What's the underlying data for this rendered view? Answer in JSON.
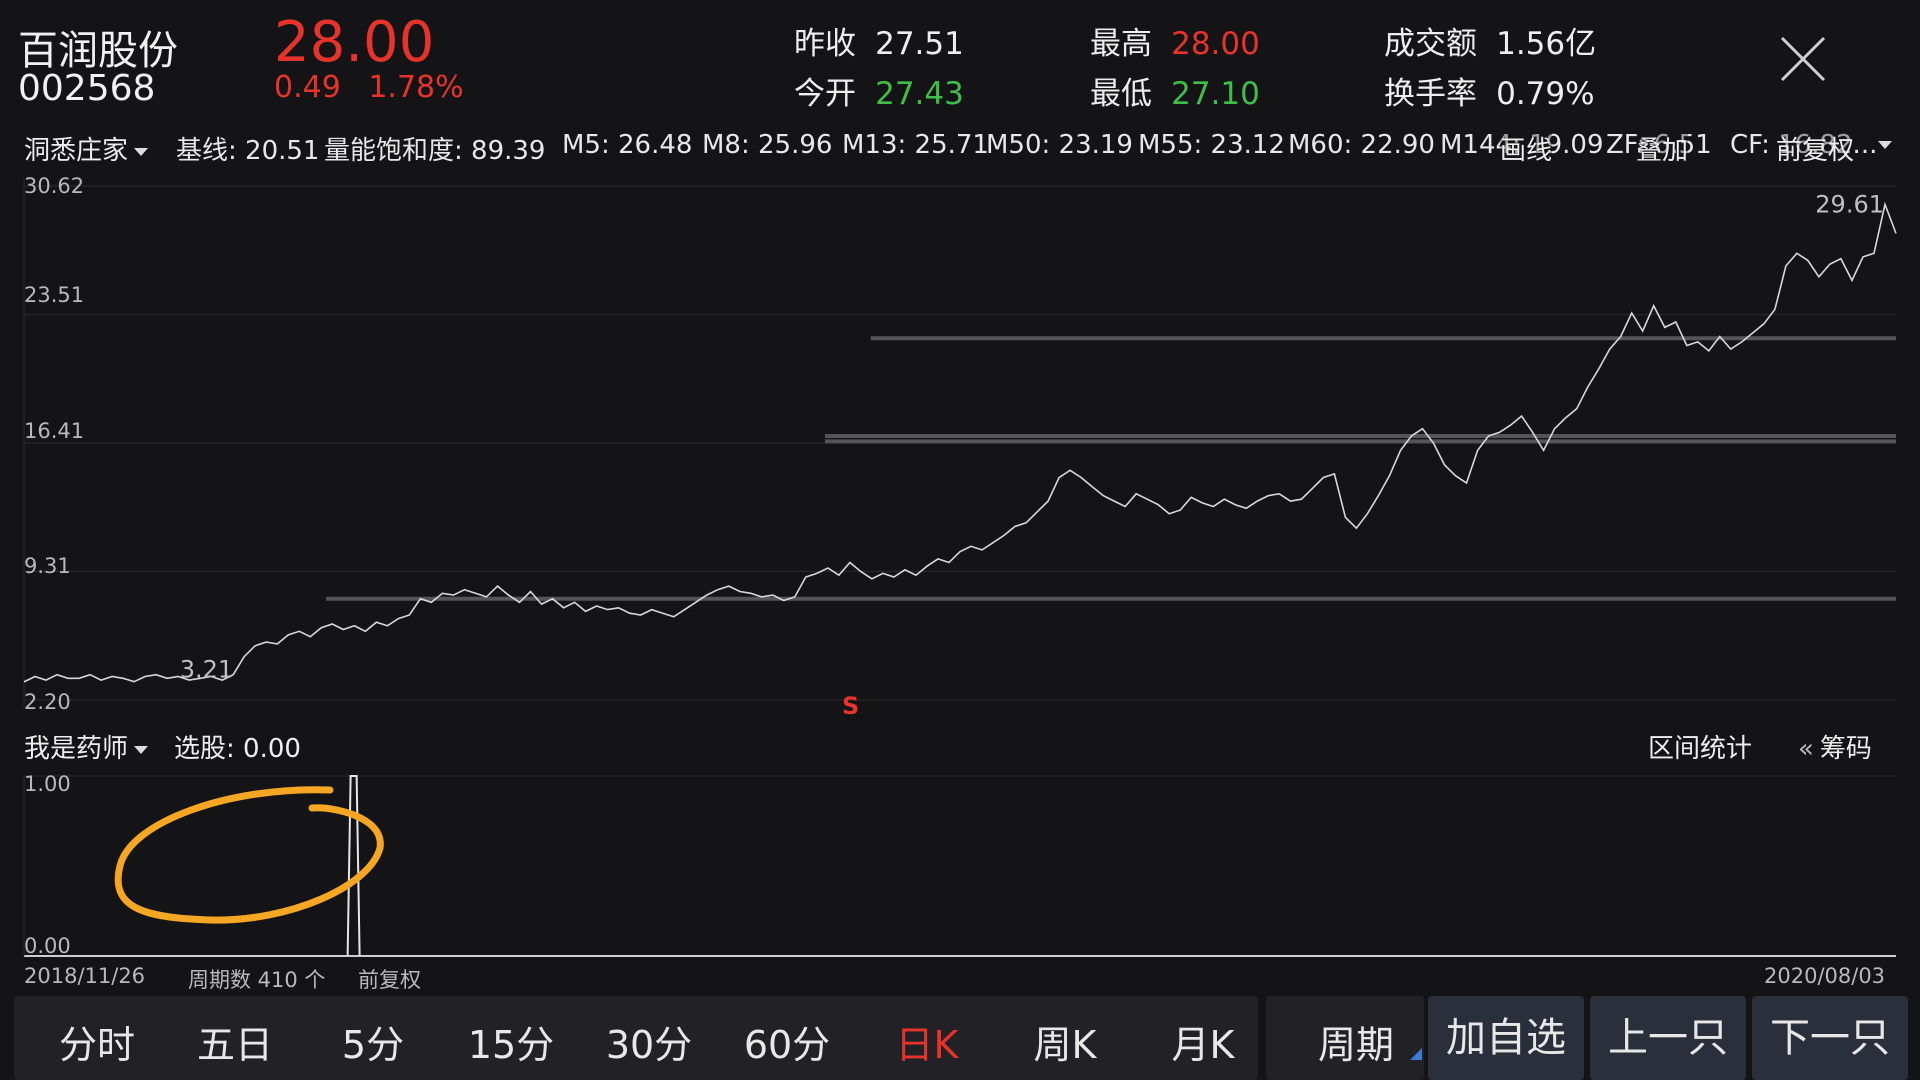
{
  "header": {
    "stock_name": "百润股份",
    "stock_code": "002568",
    "price": "28.00",
    "change": "0.49",
    "change_pct": "1.78%",
    "quotes": [
      {
        "label": "昨收",
        "value": "27.51",
        "color": "#eeeeee"
      },
      {
        "label": "今开",
        "value": "27.43",
        "color": "#3fbf4a"
      },
      {
        "label": "最高",
        "value": "28.00",
        "color": "#e8322c"
      },
      {
        "label": "最低",
        "value": "27.10",
        "color": "#3fbf4a"
      },
      {
        "label": "成交额",
        "value": "1.56亿",
        "color": "#eeeeee"
      },
      {
        "label": "换手率",
        "value": "0.79%",
        "color": "#eeeeee"
      }
    ]
  },
  "indicator_bar": {
    "selector": "洞悉庄家",
    "items": [
      {
        "text": "基线: 20.51",
        "color": "#e6d94a"
      },
      {
        "text": "量能饱和度: 89.39",
        "color": "#d94be0"
      },
      {
        "text": "M5: 26.48",
        "color": "#d94be0"
      },
      {
        "text": "M8: 25.96",
        "color": "#e6d94a"
      },
      {
        "text": "M13: 25.71",
        "color": "#8b7cf0"
      },
      {
        "text": "M50: 23.19",
        "color": "#f2f2f2"
      },
      {
        "text": "M55: 23.12",
        "color": "#3fbf4a"
      },
      {
        "text": "M60: 22.90",
        "color": "#e8322c"
      },
      {
        "text": "M144: 19.09",
        "color": "#3fbf4a"
      },
      {
        "text": "ZF: 6.51",
        "color": "#d94be0"
      },
      {
        "text": "CF: 16.82...",
        "color": "#e6d94a"
      }
    ],
    "overlay_buttons": [
      "画线",
      "叠加",
      "前复权"
    ]
  },
  "main_chart_axis": [
    "30.62",
    "23.51",
    "16.41",
    "9.31",
    "2.20"
  ],
  "signal_mark": "S",
  "sub_panel": {
    "selector": "我是药师",
    "indicator": "选股: 0.00",
    "interval_stats": "区间统计",
    "chips": "筹码",
    "axis": [
      "1.00",
      "0.00"
    ]
  },
  "footer": {
    "start_date": "2018/11/26",
    "period_count": "周期数 410 个",
    "adjust": "前复权",
    "end_date": "2020/08/03"
  },
  "toolbar": {
    "tabs": [
      "分时",
      "五日",
      "5分",
      "15分",
      "30分",
      "60分",
      "日K",
      "周K",
      "月K"
    ],
    "active_tab": "日K",
    "period": "周期",
    "add_watch": "加自选",
    "prev": "上一只",
    "next": "下一只"
  },
  "chart_data": {
    "type": "line",
    "ylim": [
      2.2,
      30.62
    ],
    "y_ticks": [
      30.62,
      23.51,
      16.41,
      9.31,
      2.2
    ],
    "x_range": [
      "2018/11/26",
      "2020/08/03"
    ],
    "period_count": 410,
    "annotations": [
      {
        "text": "3.21",
        "x_index": 10,
        "y": 3.21
      },
      {
        "text": "29.61",
        "x_index": 405,
        "y": 29.61
      }
    ],
    "series": [
      {
        "values": [
          3.2,
          3.5,
          3.3,
          3.6,
          3.4,
          3.4,
          3.6,
          3.3,
          3.5,
          3.4,
          3.21,
          3.5,
          3.6,
          3.4,
          3.5,
          3.3,
          3.4,
          3.5,
          3.3,
          3.6,
          4.6,
          5.2,
          5.4,
          5.3,
          5.8,
          6.0,
          5.7,
          6.2,
          6.4,
          6.1,
          6.3,
          6.0,
          6.5,
          6.3,
          6.7,
          6.9,
          7.8,
          7.6,
          8.1,
          8.0,
          8.3,
          8.1,
          7.9,
          8.5,
          8.0,
          7.6,
          8.2,
          7.5,
          7.8,
          7.3,
          7.6,
          7.1,
          7.4,
          7.2,
          7.3,
          7.0,
          6.9,
          7.2,
          7.0,
          6.8,
          7.2,
          7.6,
          8.0,
          8.3,
          8.5,
          8.2,
          8.1,
          7.9,
          8.0,
          7.7,
          7.9,
          9.0,
          9.2,
          9.5,
          9.1,
          9.8,
          9.3,
          8.9,
          9.2,
          9.0,
          9.4,
          9.1,
          9.6,
          10.0,
          9.8,
          10.4,
          10.7,
          10.5,
          10.9,
          11.3,
          11.8,
          12.0,
          12.6,
          13.2,
          14.5,
          14.9,
          14.5,
          14.0,
          13.5,
          13.2,
          12.9,
          13.6,
          13.3,
          13.0,
          12.5,
          12.7,
          13.4,
          13.1,
          12.9,
          13.3,
          13.0,
          12.8,
          13.2,
          13.5,
          13.6,
          13.2,
          13.3,
          13.9,
          14.5,
          14.7,
          12.3,
          11.7,
          12.5,
          13.5,
          14.6,
          16.0,
          16.8,
          17.2,
          16.4,
          15.2,
          14.6,
          14.2,
          16.0,
          16.8,
          17.0,
          17.4,
          17.9,
          17.0,
          16.0,
          17.2,
          17.8,
          18.3,
          19.5,
          20.5,
          21.6,
          22.3,
          23.6,
          22.6,
          24.0,
          22.8,
          23.1,
          21.8,
          22.0,
          21.5,
          22.3,
          21.6,
          22.0,
          22.5,
          23.0,
          23.8,
          26.2,
          26.9,
          26.5,
          25.6,
          26.3,
          26.6,
          25.4,
          26.7,
          26.9,
          29.6,
          28.0
        ]
      }
    ],
    "horizontal_bands": [
      {
        "y": 7.8,
        "from_index": 66
      },
      {
        "y": 16.5,
        "from_index": 175
      },
      {
        "y": 16.8,
        "from_index": 175
      },
      {
        "y": 22.2,
        "from_index": 185
      }
    ],
    "sub_chart": {
      "ylim": [
        0,
        1
      ],
      "spike_x_index": 60,
      "spike_value": 1.0
    }
  }
}
